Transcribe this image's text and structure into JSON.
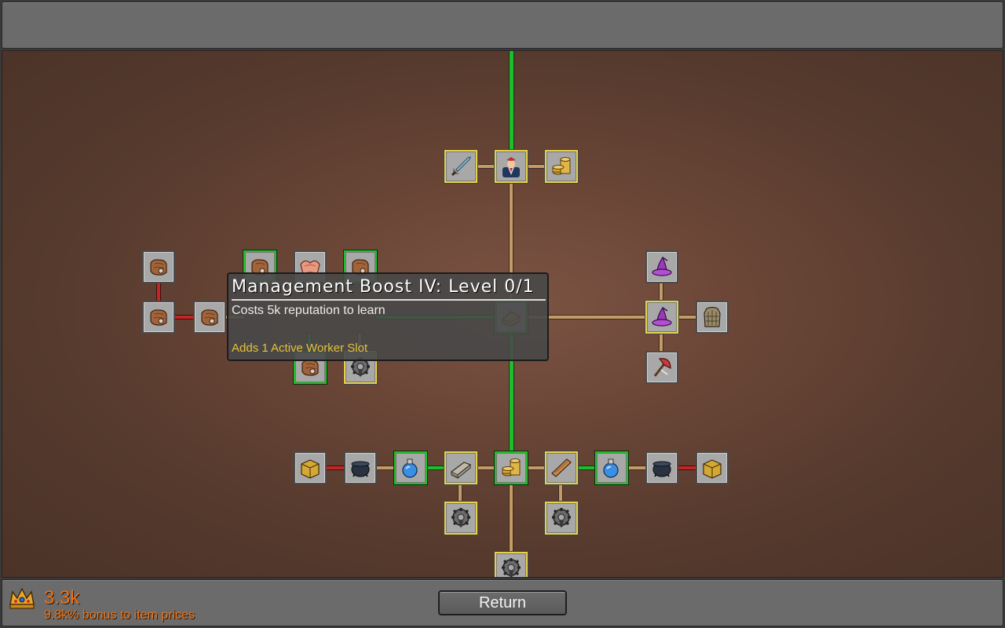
{
  "tooltip": {
    "title": "Management Boost IV: Level 0/1",
    "cost": "Costs 5k reputation to learn",
    "effect": "Adds 1 Active Worker Slot"
  },
  "footer": {
    "reputation": "3.3k",
    "bonus": "9.8k% bonus to item prices",
    "return_label": "Return"
  },
  "colors": {
    "path_tan": "#c49a67",
    "path_green": "#1fbd2e",
    "path_red": "#c42626",
    "accent_orange": "#e8731a",
    "effect_yellow": "#e4c23a"
  },
  "nodes": [
    {
      "name": "sword-node",
      "icon": "sword-icon",
      "state": "yellow"
    },
    {
      "name": "hero-node",
      "icon": "hero-icon",
      "state": "yellow"
    },
    {
      "name": "gold-coins-node-top",
      "icon": "coins-icon",
      "state": "yellow"
    },
    {
      "name": "leather-node-1",
      "icon": "leather-icon",
      "state": "grey"
    },
    {
      "name": "leather-node-2",
      "icon": "leather-icon",
      "state": "grey"
    },
    {
      "name": "leather-node-3",
      "icon": "leather-icon",
      "state": "grey"
    },
    {
      "name": "leather-node-4",
      "icon": "leather-icon",
      "state": "green"
    },
    {
      "name": "fabric-node",
      "icon": "fabric-icon",
      "state": "grey"
    },
    {
      "name": "leather-node-5",
      "icon": "leather-icon",
      "state": "green"
    },
    {
      "name": "leather-node-6",
      "icon": "leather-icon",
      "state": "green"
    },
    {
      "name": "gear-node-mid",
      "icon": "gear-icon",
      "state": "yellow"
    },
    {
      "name": "management-node",
      "icon": "scroll-icon",
      "state": "green"
    },
    {
      "name": "wizard-hat-node-1",
      "icon": "wizard-hat-icon",
      "state": "grey"
    },
    {
      "name": "wizard-hat-node-2",
      "icon": "wizard-hat-icon",
      "state": "yellow"
    },
    {
      "name": "armor-node",
      "icon": "armor-icon",
      "state": "grey"
    },
    {
      "name": "axe-node",
      "icon": "axe-icon",
      "state": "grey"
    },
    {
      "name": "chest-node-left",
      "icon": "chest-icon",
      "state": "grey"
    },
    {
      "name": "cauldron-node-left",
      "icon": "cauldron-icon",
      "state": "grey"
    },
    {
      "name": "potion-node-left",
      "icon": "potion-icon",
      "state": "green"
    },
    {
      "name": "metal-bar-node",
      "icon": "metal-bar-icon",
      "state": "yellow"
    },
    {
      "name": "gold-coins-node-bottom",
      "icon": "coins-icon",
      "state": "green"
    },
    {
      "name": "plank-node",
      "icon": "plank-icon",
      "state": "yellow"
    },
    {
      "name": "potion-node-right",
      "icon": "potion-icon",
      "state": "green"
    },
    {
      "name": "cauldron-node-right",
      "icon": "cauldron-icon",
      "state": "grey"
    },
    {
      "name": "chest-node-right",
      "icon": "chest-icon",
      "state": "grey"
    },
    {
      "name": "gear-node-lower-left",
      "icon": "gear-icon",
      "state": "yellow"
    },
    {
      "name": "gear-node-lower-right",
      "icon": "gear-icon",
      "state": "yellow"
    },
    {
      "name": "gear-node-bottom",
      "icon": "gear-icon",
      "state": "yellow"
    }
  ]
}
